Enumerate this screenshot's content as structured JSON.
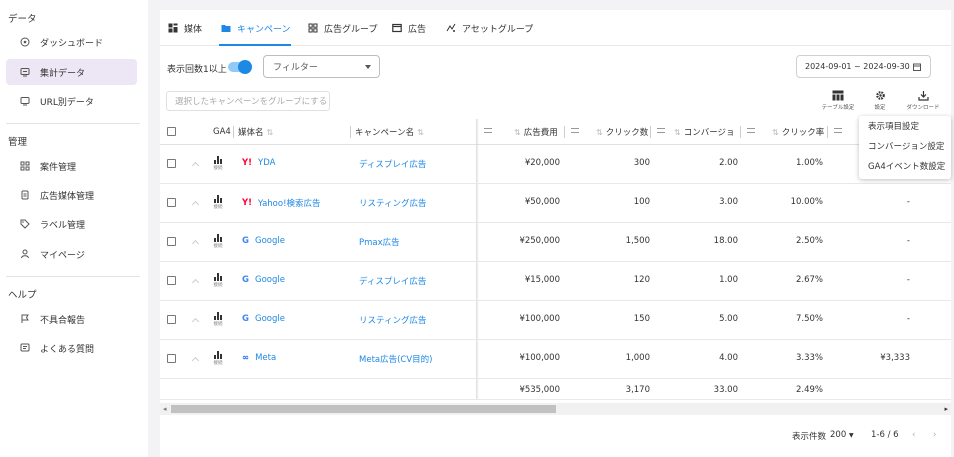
{
  "sidebar": {
    "sections": [
      {
        "title": "データ",
        "items": [
          {
            "label": "ダッシュボード",
            "icon": "dashboard-icon"
          },
          {
            "label": "集計データ",
            "icon": "aggregate-data-icon",
            "active": true
          },
          {
            "label": "URL別データ",
            "icon": "url-data-icon"
          }
        ]
      },
      {
        "title": "管理",
        "items": [
          {
            "label": "案件管理",
            "icon": "project-icon"
          },
          {
            "label": "広告媒体管理",
            "icon": "ad-media-icon"
          },
          {
            "label": "ラベル管理",
            "icon": "label-icon"
          },
          {
            "label": "マイページ",
            "icon": "user-icon"
          }
        ]
      },
      {
        "title": "ヘルプ",
        "items": [
          {
            "label": "不具合報告",
            "icon": "flag-icon"
          },
          {
            "label": "よくある質問",
            "icon": "faq-icon"
          }
        ]
      }
    ]
  },
  "tabs": [
    {
      "label": "媒体",
      "icon": "media-icon"
    },
    {
      "label": "キャンペーン",
      "icon": "folder-icon",
      "active": true
    },
    {
      "label": "広告グループ",
      "icon": "grid-icon"
    },
    {
      "label": "広告",
      "icon": "ad-icon"
    },
    {
      "label": "アセットグループ",
      "icon": "asset-group-icon"
    }
  ],
  "controls": {
    "impressions_toggle_label": "表示回数1以上",
    "impressions_toggle_on": true,
    "filter_placeholder": "フィルター",
    "date_range": "2024-09-01 ~ 2024-09-30",
    "group_button": "選択したキャンペーンをグループにする",
    "table_settings": "テーブル設定",
    "settings": "設定",
    "download": "ダウンロード"
  },
  "settings_menu": [
    "表示項目設定",
    "コンバージョン設定",
    "GA4イベント数設定"
  ],
  "columns": {
    "ga4": "GA4",
    "media": "媒体名",
    "campaign": "キャンペーン名",
    "cost": "広告費用",
    "clicks": "クリック数",
    "conversions": "コンバージョ",
    "ctr": "クリック率"
  },
  "ga4_link_label": "接続",
  "rows": [
    {
      "media": "YDA",
      "logo": "Y!",
      "logo_color": "#ff0033",
      "campaign": "ディスプレイ広告",
      "cost": "¥20,000",
      "clicks": "300",
      "conversions": "2.00",
      "ctr": "1.00%",
      "extra": ""
    },
    {
      "media": "Yahoo!検索広告",
      "logo": "Y!",
      "logo_color": "#ff0033",
      "campaign": "リスティング広告",
      "cost": "¥50,000",
      "clicks": "100",
      "conversions": "3.00",
      "ctr": "10.00%",
      "extra": "-"
    },
    {
      "media": "Google",
      "logo": "G",
      "logo_color": "#4285f4",
      "campaign": "Pmax広告",
      "cost": "¥250,000",
      "clicks": "1,500",
      "conversions": "18.00",
      "ctr": "2.50%",
      "extra": "-"
    },
    {
      "media": "Google",
      "logo": "G",
      "logo_color": "#4285f4",
      "campaign": "ディスプレイ広告",
      "cost": "¥15,000",
      "clicks": "120",
      "conversions": "1.00",
      "ctr": "2.67%",
      "extra": "-"
    },
    {
      "media": "Google",
      "logo": "G",
      "logo_color": "#4285f4",
      "campaign": "リスティング広告",
      "cost": "¥100,000",
      "clicks": "150",
      "conversions": "5.00",
      "ctr": "7.50%",
      "extra": "-"
    },
    {
      "media": "Meta",
      "logo": "∞",
      "logo_color": "#0866ff",
      "campaign": "Meta広告(CV目的)",
      "cost": "¥100,000",
      "clicks": "1,000",
      "conversions": "4.00",
      "ctr": "3.33%",
      "extra": "¥3,333"
    }
  ],
  "totals": {
    "cost": "¥535,000",
    "clicks": "3,170",
    "conversions": "33.00",
    "ctr": "2.49%"
  },
  "footer": {
    "rows_per_page_label": "表示件数",
    "rows_per_page": "200",
    "page_range": "1-6 / 6"
  }
}
